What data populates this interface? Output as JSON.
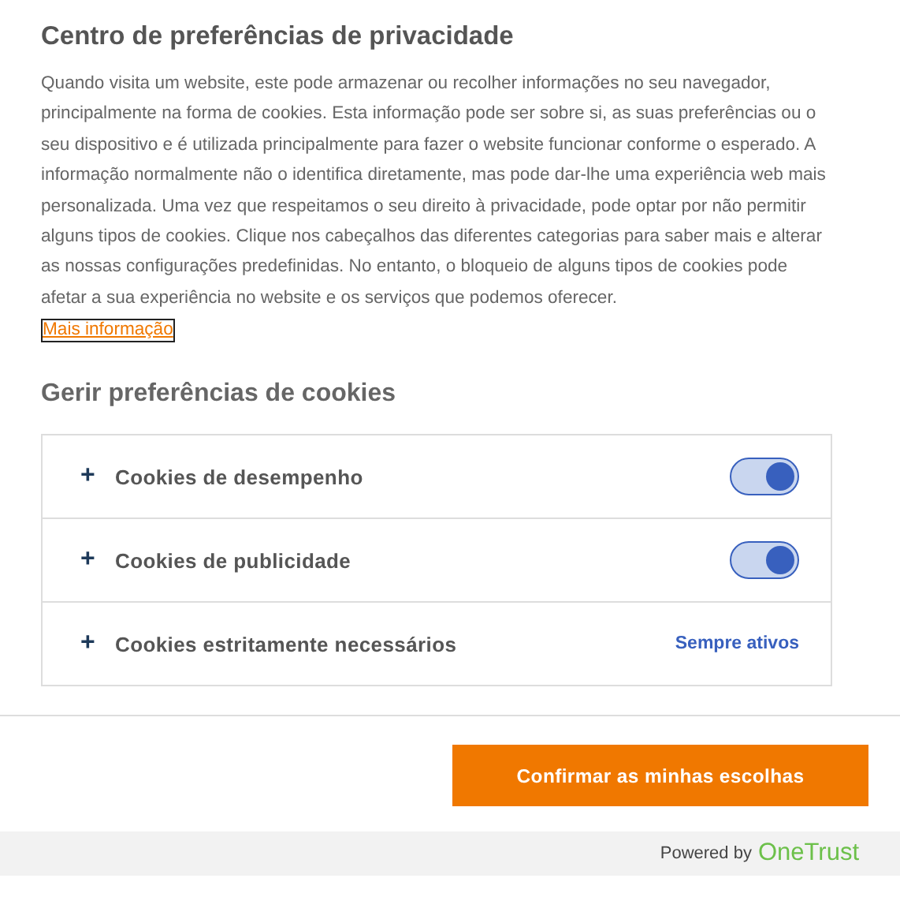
{
  "title": "Centro de preferências de privacidade",
  "description": "Quando visita um website, este pode armazenar ou recolher informações no seu navegador, principalmente na forma de cookies. Esta informação pode ser sobre si, as suas preferências ou o seu dispositivo e é utilizada principalmente para fazer o website funcionar conforme o esperado. A informação normalmente não o identifica diretamente, mas pode dar-lhe uma experiência web mais personalizada. Uma vez que respeitamos o seu direito à privacidade, pode optar por não permitir alguns tipos de cookies. Clique nos cabeçalhos das diferentes categorias para saber mais e alterar as nossas configurações predefinidas. No entanto, o bloqueio de alguns tipos de cookies pode afetar a sua experiência no website e os serviços que podemos oferecer.",
  "more_link": "Mais informação",
  "section_title": "Gerir preferências de cookies",
  "categories": [
    {
      "expander": "+",
      "label": "Cookies de desempenho",
      "kind": "toggle",
      "on": true
    },
    {
      "expander": "+",
      "label": "Cookies de publicidade",
      "kind": "toggle",
      "on": true
    },
    {
      "expander": "+",
      "label": "Cookies estritamente necessários",
      "kind": "always",
      "status": "Sempre ativos"
    }
  ],
  "confirm_button": "Confirmar as minhas escolhas",
  "footer": {
    "powered_by": "Powered by",
    "brand": "OneTrust"
  }
}
